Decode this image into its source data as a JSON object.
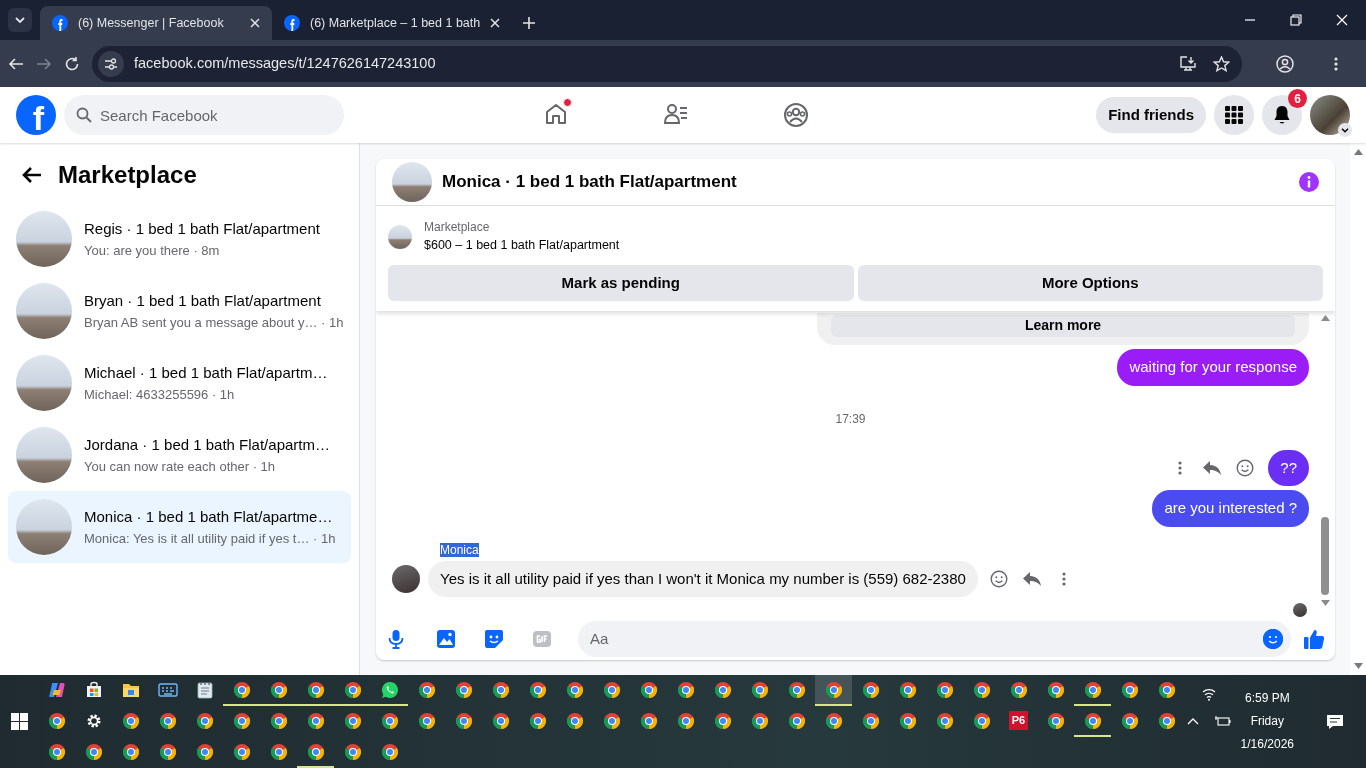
{
  "browser": {
    "tabs": [
      {
        "title": "(6) Messenger | Facebook",
        "selected": true
      },
      {
        "title": "(6) Marketplace – 1 bed 1 bath",
        "selected": false
      }
    ],
    "url": "facebook.com/messages/t/1247626147243100"
  },
  "topbar": {
    "logo": "f",
    "search_placeholder": "Search Facebook",
    "nav": [
      {
        "kind": "home",
        "dot": true
      },
      {
        "kind": "friends",
        "dot": false
      },
      {
        "kind": "groups",
        "dot": false
      }
    ],
    "find_friends": "Find friends",
    "notifications": "6"
  },
  "sidebar": {
    "title": "Marketplace",
    "conversations": [
      {
        "title": "Regis · 1 bed 1 bath Flat/apartment",
        "preview": "You: are you there · 8m",
        "selected": false
      },
      {
        "title": "Bryan · 1 bed 1 bath Flat/apartment",
        "preview": "Bryan AB sent you a message about y…  · 1h",
        "selected": false
      },
      {
        "title": "Michael · 1 bed 1 bath Flat/apartm…",
        "preview": "Michael: 4633255596 · 1h",
        "selected": false
      },
      {
        "title": "Jordana · 1 bed 1 bath Flat/apartm…",
        "preview": "You can now rate each other · 1h",
        "selected": false
      },
      {
        "title": "Monica · 1 bed 1 bath Flat/apartme…",
        "preview": "Monica: Yes is it all utility paid if yes t…  · 1h",
        "selected": true
      }
    ]
  },
  "chat": {
    "title": "Monica · 1 bed 1 bath Flat/apartment",
    "listing": {
      "label": "Marketplace",
      "title": "$600 – 1 bed 1 bath Flat/apartment"
    },
    "actions": [
      "Mark as pending",
      "More Options"
    ],
    "messages": [
      {
        "kind": "card",
        "button": "Learn more"
      },
      {
        "kind": "outgoing",
        "text": "waiting for your response",
        "color": "#9a1cf6",
        "actions": false
      },
      {
        "kind": "timestamp",
        "text": "17:39"
      },
      {
        "kind": "outgoing",
        "text": "??",
        "color": "#6b2ef4",
        "actions": true
      },
      {
        "kind": "outgoing",
        "text": "are you interested ?",
        "color": "#4b4cf0",
        "actions": false
      },
      {
        "kind": "incoming",
        "sender": "Monica",
        "highlighted": true,
        "text": "Yes is it all utility paid if yes than I won't it Monica my number is (559) 682-2380",
        "actions": true
      },
      {
        "kind": "seen"
      }
    ],
    "composer": {
      "placeholder": "Aa"
    }
  },
  "taskbar": {
    "rows": [
      [
        {
          "kind": "copilot",
          "running": false
        },
        {
          "kind": "store",
          "running": false
        },
        {
          "kind": "folder",
          "running": false
        },
        {
          "kind": "keyboard",
          "running": false
        },
        {
          "kind": "notepad",
          "running": false
        },
        {
          "kind": "chrome",
          "running": true
        },
        {
          "kind": "chrome",
          "running": true
        },
        {
          "kind": "chrome",
          "running": true
        },
        {
          "kind": "chrome",
          "running": true
        },
        {
          "kind": "whatsapp",
          "running": true
        },
        {
          "kind": "chrome",
          "running": false
        },
        {
          "kind": "chrome",
          "running": false
        },
        {
          "kind": "chrome",
          "running": false
        },
        {
          "kind": "chrome",
          "running": false
        },
        {
          "kind": "chrome",
          "running": false
        },
        {
          "kind": "chrome",
          "running": false
        },
        {
          "kind": "chrome",
          "running": false
        },
        {
          "kind": "chrome",
          "running": false
        },
        {
          "kind": "chrome",
          "running": false
        },
        {
          "kind": "chrome",
          "running": false
        },
        {
          "kind": "chrome",
          "running": false
        },
        {
          "kind": "chrome",
          "running": true,
          "selected": true
        },
        {
          "kind": "chrome",
          "running": false
        },
        {
          "kind": "chrome",
          "running": false
        },
        {
          "kind": "chrome",
          "running": false
        },
        {
          "kind": "chrome",
          "running": false
        },
        {
          "kind": "chrome",
          "running": false
        },
        {
          "kind": "chrome",
          "running": false
        },
        {
          "kind": "chrome",
          "running": true
        },
        {
          "kind": "chrome",
          "running": false
        },
        {
          "kind": "chrome",
          "running": false
        }
      ],
      [
        {
          "kind": "chrome",
          "running": false
        },
        {
          "kind": "settings",
          "running": false
        },
        {
          "kind": "chrome",
          "running": false
        },
        {
          "kind": "chrome",
          "running": false
        },
        {
          "kind": "chrome",
          "running": false
        },
        {
          "kind": "chrome",
          "running": false
        },
        {
          "kind": "chrome",
          "running": false
        },
        {
          "kind": "chrome",
          "running": false
        },
        {
          "kind": "chrome",
          "running": false
        },
        {
          "kind": "chrome",
          "running": false
        },
        {
          "kind": "chrome",
          "running": false
        },
        {
          "kind": "chrome",
          "running": false
        },
        {
          "kind": "chrome",
          "running": false
        },
        {
          "kind": "chrome",
          "running": false
        },
        {
          "kind": "chrome",
          "running": false
        },
        {
          "kind": "chrome",
          "running": false
        },
        {
          "kind": "chrome",
          "running": false
        },
        {
          "kind": "chrome",
          "running": false
        },
        {
          "kind": "chrome",
          "running": false
        },
        {
          "kind": "chrome",
          "running": false
        },
        {
          "kind": "chrome",
          "running": false
        },
        {
          "kind": "chrome",
          "running": false
        },
        {
          "kind": "chrome",
          "running": false
        },
        {
          "kind": "chrome",
          "running": false
        },
        {
          "kind": "chrome",
          "running": false
        },
        {
          "kind": "chrome",
          "running": false
        },
        {
          "kind": "text-tile",
          "label": "P6",
          "running": false
        },
        {
          "kind": "chrome",
          "running": false
        },
        {
          "kind": "chrome",
          "running": true
        },
        {
          "kind": "chrome",
          "running": false
        },
        {
          "kind": "chrome",
          "running": false
        }
      ],
      [
        {
          "kind": "chrome",
          "running": false
        },
        {
          "kind": "chrome",
          "running": false
        },
        {
          "kind": "chrome",
          "running": false
        },
        {
          "kind": "chrome",
          "running": false
        },
        {
          "kind": "chrome",
          "running": false
        },
        {
          "kind": "chrome",
          "running": false
        },
        {
          "kind": "chrome",
          "running": false
        },
        {
          "kind": "chrome",
          "running": true
        },
        {
          "kind": "chrome",
          "running": false
        },
        {
          "kind": "chrome",
          "running": false
        }
      ]
    ],
    "clock": {
      "time": "6:59 PM",
      "day": "Friday",
      "date": "1/16/2026"
    }
  }
}
